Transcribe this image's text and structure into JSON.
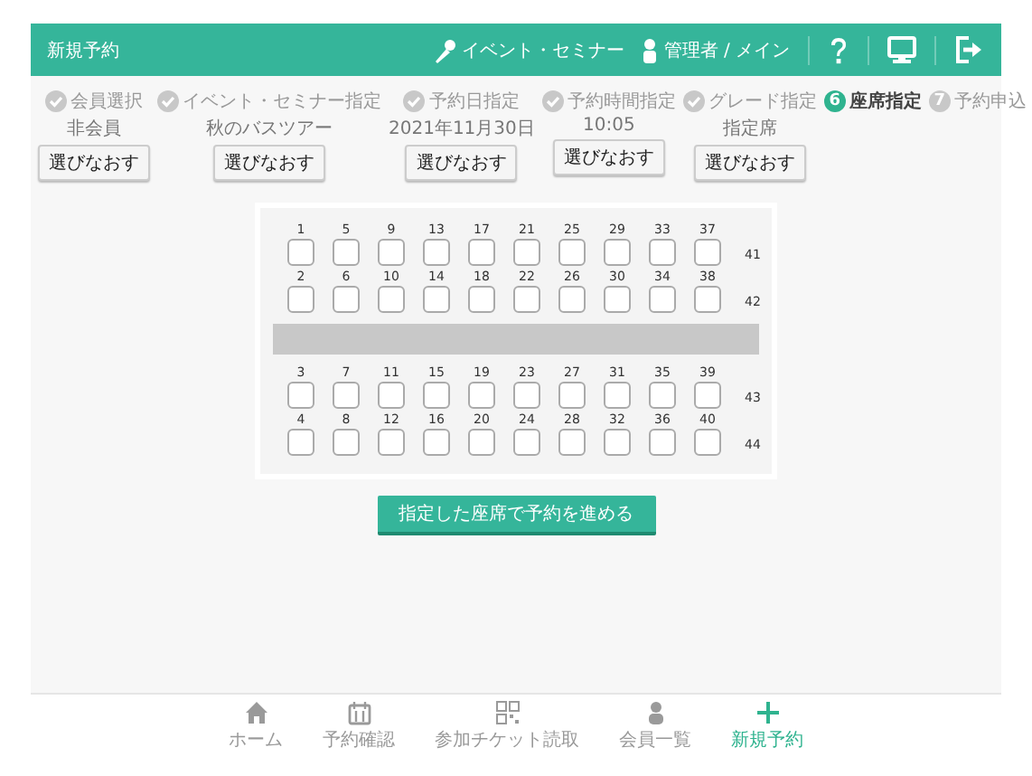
{
  "header": {
    "title": "新規予約",
    "event_link": "イベント・セミナー",
    "user_link": "管理者 / メイン"
  },
  "steps": [
    {
      "kind": "done",
      "label": "会員選択",
      "value": "非会員",
      "button": "選びなおす"
    },
    {
      "kind": "done",
      "label": "イベント・セミナー指定",
      "value": "秋のバスツアー",
      "button": "選びなおす"
    },
    {
      "kind": "done",
      "label": "予約日指定",
      "value": "2021年11月30日",
      "button": "選びなおす"
    },
    {
      "kind": "done",
      "label": "予約時間指定",
      "value": "10:05",
      "button": "選びなおす"
    },
    {
      "kind": "done",
      "label": "グレード指定",
      "value": "指定席",
      "button": "選びなおす"
    },
    {
      "kind": "current",
      "number": "6",
      "label": "座席指定"
    },
    {
      "kind": "pending",
      "number": "7",
      "label": "予約申込"
    }
  ],
  "seat_map": [
    {
      "kind": "seats",
      "row_label": "41",
      "seats": [
        {
          "number": "1",
          "checked": false
        },
        {
          "number": "5",
          "checked": false
        },
        {
          "number": "9",
          "checked": false
        },
        {
          "number": "13",
          "checked": false
        },
        {
          "number": "17",
          "checked": false
        },
        {
          "number": "21",
          "checked": false
        },
        {
          "number": "25",
          "checked": false
        },
        {
          "number": "29",
          "checked": false
        },
        {
          "number": "33",
          "checked": false
        },
        {
          "number": "37",
          "checked": false
        }
      ]
    },
    {
      "kind": "seats",
      "row_label": "42",
      "seats": [
        {
          "number": "2",
          "checked": false
        },
        {
          "number": "6",
          "checked": false
        },
        {
          "number": "10",
          "checked": false
        },
        {
          "number": "14",
          "checked": false
        },
        {
          "number": "18",
          "checked": false
        },
        {
          "number": "22",
          "checked": false
        },
        {
          "number": "26",
          "checked": false
        },
        {
          "number": "30",
          "checked": false
        },
        {
          "number": "34",
          "checked": false
        },
        {
          "number": "38",
          "checked": false
        }
      ]
    },
    {
      "kind": "aisle"
    },
    {
      "kind": "seats",
      "row_label": "43",
      "seats": [
        {
          "number": "3",
          "checked": false
        },
        {
          "number": "7",
          "checked": false
        },
        {
          "number": "11",
          "checked": false
        },
        {
          "number": "15",
          "checked": false
        },
        {
          "number": "19",
          "checked": false
        },
        {
          "number": "23",
          "checked": false
        },
        {
          "number": "27",
          "checked": false
        },
        {
          "number": "31",
          "checked": false
        },
        {
          "number": "35",
          "checked": false
        },
        {
          "number": "39",
          "checked": false
        }
      ]
    },
    {
      "kind": "seats",
      "row_label": "44",
      "seats": [
        {
          "number": "4",
          "checked": false
        },
        {
          "number": "8",
          "checked": false
        },
        {
          "number": "12",
          "checked": false
        },
        {
          "number": "16",
          "checked": false
        },
        {
          "number": "20",
          "checked": false
        },
        {
          "number": "24",
          "checked": false
        },
        {
          "number": "28",
          "checked": false
        },
        {
          "number": "32",
          "checked": false
        },
        {
          "number": "36",
          "checked": false
        },
        {
          "number": "40",
          "checked": false
        }
      ]
    }
  ],
  "submit_button": "指定した座席で予約を進める",
  "bottom_nav": [
    {
      "kind": "home",
      "label": "ホーム",
      "selected": false
    },
    {
      "kind": "calendar",
      "label": "予約確認",
      "selected": false
    },
    {
      "kind": "qr",
      "label": "参加チケット読取",
      "selected": false
    },
    {
      "kind": "person",
      "label": "会員一覧",
      "selected": false
    },
    {
      "kind": "plus",
      "label": "新規予約",
      "selected": true
    }
  ]
}
